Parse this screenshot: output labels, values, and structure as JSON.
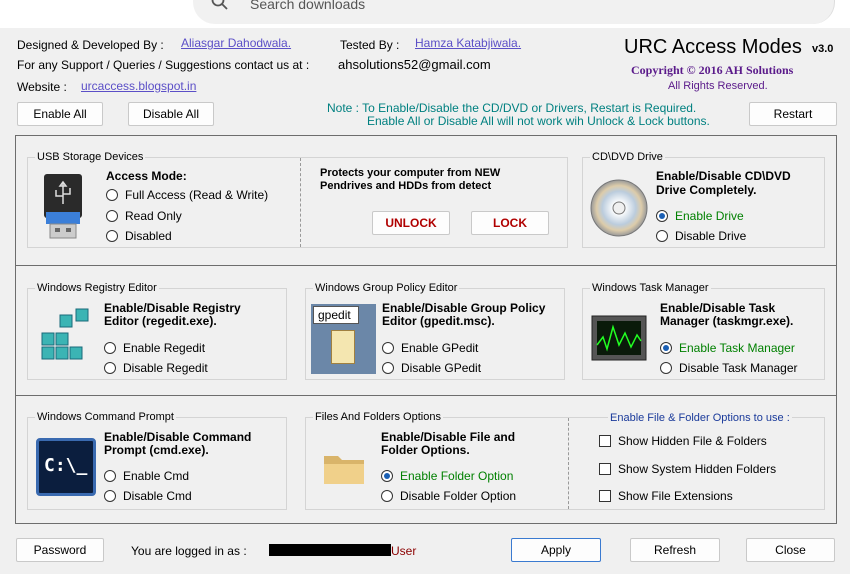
{
  "browser": {
    "search_placeholder": "Search downloads"
  },
  "header": {
    "designed_label": "Designed & Developed By :",
    "designer": "Aliasgar Dahodwala.",
    "tested_label": "Tested By :",
    "tester": "Hamza Katabjiwala.",
    "support_label": "For any Support / Queries / Suggestions contact us at :",
    "email": "ahsolutions52@gmail.com",
    "website_label": "Website :",
    "website": "urcaccess.blogspot.in",
    "app_title": "URC Access Modes",
    "version": "v3.0",
    "copyright": "Copyright © 2016 AH Solutions",
    "rights": "All Rights Reserved."
  },
  "toolbar": {
    "enable_all": "Enable All",
    "disable_all": "Disable All",
    "restart": "Restart",
    "note_line1": "Note : To Enable/Disable the CD/DVD or Drivers, Restart is Required.",
    "note_line2": "Enable All or Disable All will not work wih Unlock & Lock buttons."
  },
  "usb": {
    "title": "USB Storage Devices",
    "access_mode": "Access Mode:",
    "options": [
      "Full Access (Read & Write)",
      "Read Only",
      "Disabled"
    ],
    "desc": "Protects your computer from NEW",
    "desc2": "Pendrives and HDDs from detect",
    "unlock": "UNLOCK",
    "lock": "LOCK"
  },
  "cd": {
    "title": "CD\\DVD Drive",
    "desc": "Enable/Disable CD\\DVD",
    "desc2": "Drive Completely.",
    "options": [
      "Enable Drive",
      "Disable Drive"
    ]
  },
  "regedit": {
    "title": "Windows Registry Editor",
    "desc": "Enable/Disable Registry",
    "desc2": "Editor (regedit.exe).",
    "options": [
      "Enable Regedit",
      "Disable Regedit"
    ]
  },
  "gpedit": {
    "title": "Windows Group Policy Editor",
    "icon_label": "gpedit",
    "desc": "Enable/Disable Group Policy",
    "desc2": "Editor (gpedit.msc).",
    "options": [
      "Enable GPedit",
      "Disable GPedit"
    ]
  },
  "taskmgr": {
    "title": "Windows Task Manager",
    "desc": "Enable/Disable Task",
    "desc2": "Manager (taskmgr.exe).",
    "options": [
      "Enable Task Manager",
      "Disable Task Manager"
    ]
  },
  "cmd": {
    "title": "Windows Command Prompt",
    "icon_label": "C:\\_",
    "desc": "Enable/Disable Command",
    "desc2": "Prompt (cmd.exe).",
    "options": [
      "Enable Cmd",
      "Disable Cmd"
    ]
  },
  "folders": {
    "title": "Files And Folders Options",
    "desc": "Enable/Disable File and",
    "desc2": "Folder Options.",
    "options": [
      "Enable Folder Option",
      "Disable Folder Option"
    ],
    "use_label": "Enable File & Folder Options to use :",
    "checks": [
      "Show Hidden File & Folders",
      "Show System Hidden Folders",
      "Show File Extensions"
    ]
  },
  "footer": {
    "password": "Password",
    "logged_in": "You are logged in as :",
    "role": "User",
    "apply": "Apply",
    "refresh": "Refresh",
    "close": "Close"
  },
  "colors": {
    "link": "#5b4fc7",
    "note": "#008080",
    "enabled": "#008000",
    "copyright": "#5a1a8a",
    "role": "#8b0000",
    "lock": "#b00000"
  }
}
